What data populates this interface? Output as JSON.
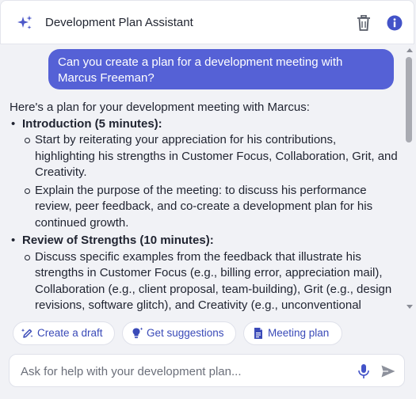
{
  "header": {
    "title": "Development Plan Assistant",
    "icons": [
      "sparkle-icon",
      "trash-icon",
      "info-icon"
    ]
  },
  "chat": {
    "user_message": "Can you create a plan for a development meeting with Marcus Freeman?",
    "assistant": {
      "intro": "Here's a plan for your development meeting with Marcus:",
      "sections": [
        {
          "title": "Introduction (5 minutes):",
          "items": [
            "Start by reiterating your appreciation for his contributions, highlighting his strengths in Customer Focus, Collaboration, Grit, and Creativity.",
            "Explain the purpose of the meeting: to discuss his performance review, peer feedback, and co-create a development plan for his continued growth."
          ]
        },
        {
          "title": "Review of Strengths (10 minutes):",
          "items": [
            "Discuss specific examples from the feedback that illustrate his strengths in Customer Focus (e.g., billing error, appreciation mail), Collaboration (e.g., client proposal, team-building), Grit (e.g., design revisions, software glitch), and Creativity (e.g., unconventional software solution)."
          ]
        }
      ]
    }
  },
  "suggestions": [
    {
      "label": "Create a draft",
      "icon": "edit-sparkle-icon"
    },
    {
      "label": "Get suggestions",
      "icon": "lightbulb-sparkle-icon"
    },
    {
      "label": "Meeting plan",
      "icon": "document-icon"
    }
  ],
  "composer": {
    "placeholder": "Ask for help with your development plan...",
    "value": ""
  },
  "colors": {
    "accent": "#5561d6",
    "chip_text": "#3a4ab8",
    "background": "#f1f2f6"
  }
}
